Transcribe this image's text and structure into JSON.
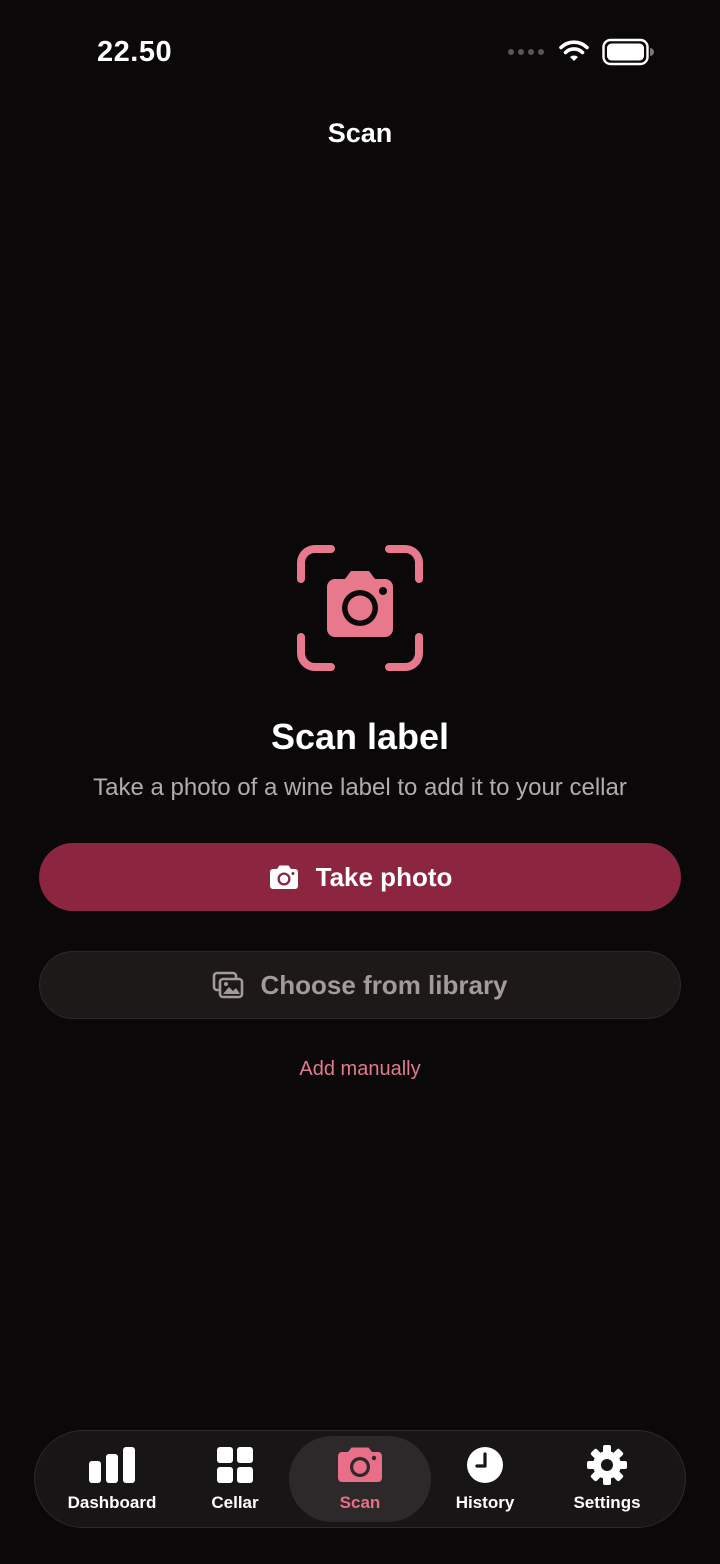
{
  "status_bar": {
    "time": "22.50"
  },
  "nav": {
    "title": "Scan"
  },
  "hero": {
    "icon": "camera-viewfinder-icon",
    "title": "Scan label",
    "subtitle": "Take a photo of a wine label to add it to your cellar"
  },
  "actions": {
    "take_photo_label": "Take photo",
    "take_photo_icon": "camera-icon",
    "library_label": "Choose from library",
    "library_icon": "photo-stack-icon",
    "manual_label": "Add manually"
  },
  "tabs": [
    {
      "label": "Dashboard",
      "icon": "bar-chart-icon",
      "active": false
    },
    {
      "label": "Cellar",
      "icon": "grid-icon",
      "active": false
    },
    {
      "label": "Scan",
      "icon": "camera-icon",
      "active": true
    },
    {
      "label": "History",
      "icon": "clock-icon",
      "active": false
    },
    {
      "label": "Settings",
      "icon": "gear-icon",
      "active": false
    }
  ],
  "colors": {
    "background": "#0b0809",
    "accent": "#e86f87",
    "primary_button": "#8c2640",
    "secondary_button": "#1d1919"
  }
}
